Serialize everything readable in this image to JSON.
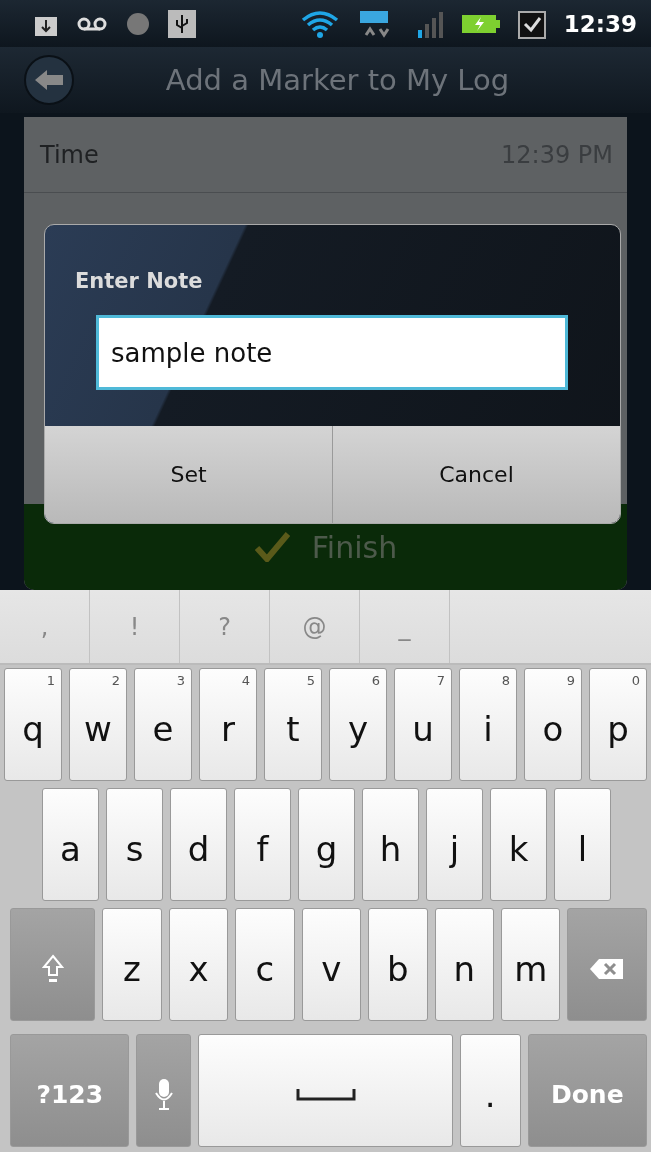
{
  "status_bar": {
    "time": "12:39"
  },
  "header": {
    "title": "Add a Marker to My Log"
  },
  "rows": [
    {
      "label": "Time",
      "value": "12:39 PM"
    }
  ],
  "finish_button": {
    "label": "Finish"
  },
  "dialog": {
    "title": "Enter Note",
    "value": "sample note",
    "buttons": [
      "Set",
      "Cancel"
    ]
  },
  "suggestions": [
    ",",
    "!",
    "?",
    "@",
    "_"
  ],
  "keyboard": {
    "top_row": [
      {
        "kind": "letter",
        "label": "q",
        "hint": "1"
      },
      {
        "kind": "letter",
        "label": "w",
        "hint": "2"
      },
      {
        "kind": "letter",
        "label": "e",
        "hint": "3"
      },
      {
        "kind": "letter",
        "label": "r",
        "hint": "4"
      },
      {
        "kind": "letter",
        "label": "t",
        "hint": "5"
      },
      {
        "kind": "letter",
        "label": "y",
        "hint": "6"
      },
      {
        "kind": "letter",
        "label": "u",
        "hint": "7"
      },
      {
        "kind": "letter",
        "label": "i",
        "hint": "8"
      },
      {
        "kind": "letter",
        "label": "o",
        "hint": "9"
      },
      {
        "kind": "letter",
        "label": "p",
        "hint": "0"
      }
    ],
    "home_row": [
      {
        "kind": "letter",
        "label": "a"
      },
      {
        "kind": "letter",
        "label": "s"
      },
      {
        "kind": "letter",
        "label": "d"
      },
      {
        "kind": "letter",
        "label": "f"
      },
      {
        "kind": "letter",
        "label": "g"
      },
      {
        "kind": "letter",
        "label": "h"
      },
      {
        "kind": "letter",
        "label": "j"
      },
      {
        "kind": "letter",
        "label": "k"
      },
      {
        "kind": "letter",
        "label": "l"
      }
    ],
    "bottom_row": [
      {
        "kind": "shift"
      },
      {
        "kind": "letter",
        "label": "z"
      },
      {
        "kind": "letter",
        "label": "x"
      },
      {
        "kind": "letter",
        "label": "c"
      },
      {
        "kind": "letter",
        "label": "v"
      },
      {
        "kind": "letter",
        "label": "b"
      },
      {
        "kind": "letter",
        "label": "n"
      },
      {
        "kind": "letter",
        "label": "m"
      },
      {
        "kind": "backspace"
      }
    ],
    "function_row": [
      {
        "kind": "symbols",
        "label": "?123"
      },
      {
        "kind": "mic"
      },
      {
        "kind": "space"
      },
      {
        "kind": "letter",
        "label": "."
      },
      {
        "kind": "done",
        "label": "Done"
      }
    ]
  }
}
